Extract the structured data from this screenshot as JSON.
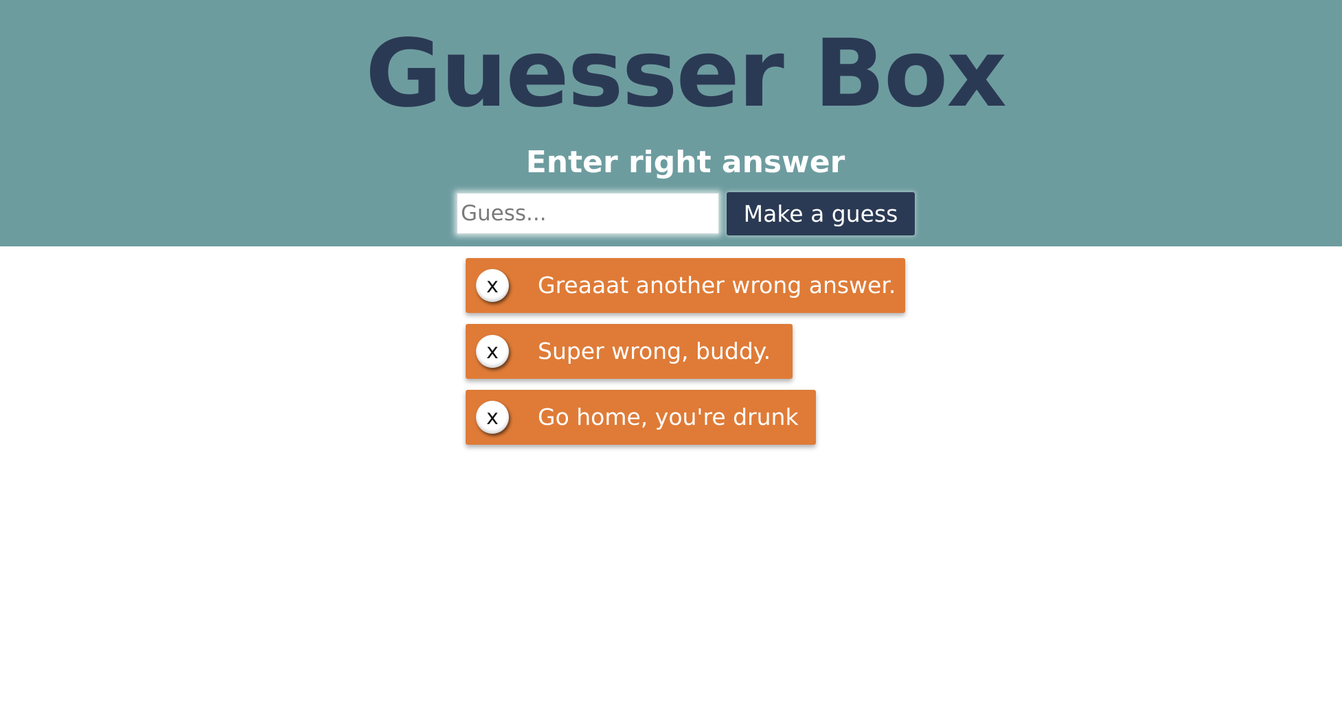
{
  "header": {
    "title": "Guesser Box",
    "prompt": "Enter right answer",
    "input": {
      "placeholder": "Guess...",
      "value": ""
    },
    "button_label": "Make a guess",
    "background_color": "#6d9c9f",
    "title_color": "#2b3a54"
  },
  "messages": [
    {
      "dismiss_label": "x",
      "text": "Greaaat another wrong answer."
    },
    {
      "dismiss_label": "x",
      "text": "Super wrong, buddy."
    },
    {
      "dismiss_label": "x",
      "text": "Go home, you're drunk"
    }
  ],
  "message_color": "#df7b37",
  "icons": {
    "dismiss": "close-icon"
  }
}
